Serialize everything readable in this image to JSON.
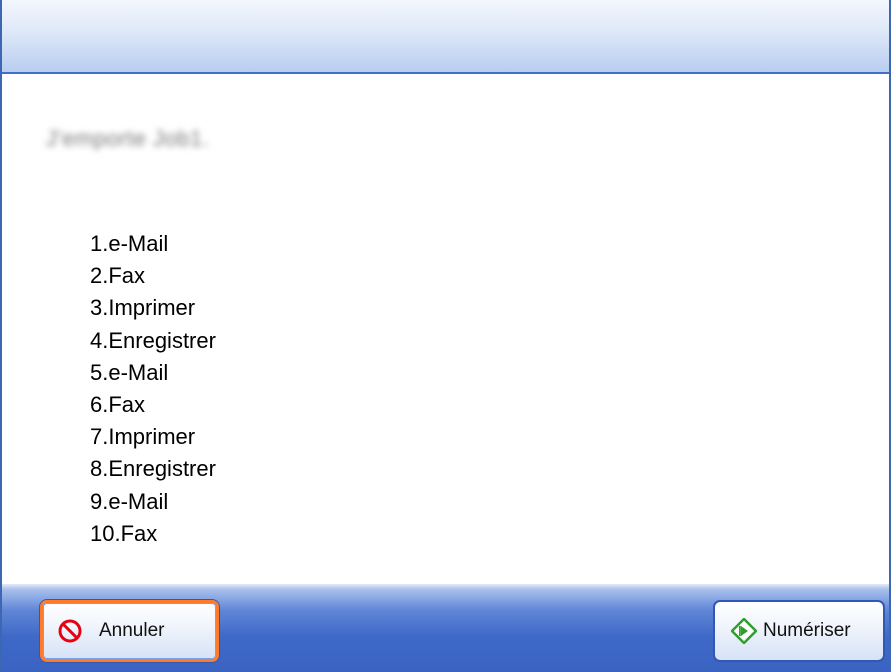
{
  "title": "J'emporte Job1.",
  "items": [
    "1.e-Mail",
    "2.Fax",
    "3.Imprimer",
    "4.Enregistrer",
    "5.e-Mail",
    "6.Fax",
    "7.Imprimer",
    "8.Enregistrer",
    "9.e-Mail",
    "10.Fax"
  ],
  "footer": {
    "cancel_label": "Annuler",
    "cancel_icon": "no-entry-icon",
    "scan_label": "Numériser",
    "scan_icon": "green-diamond-start-icon"
  },
  "colors": {
    "accent": "#3d66b3",
    "focus_border": "#ff7a2a",
    "cancel_icon": "#e60012",
    "scan_icon": "#2f9e2f"
  }
}
